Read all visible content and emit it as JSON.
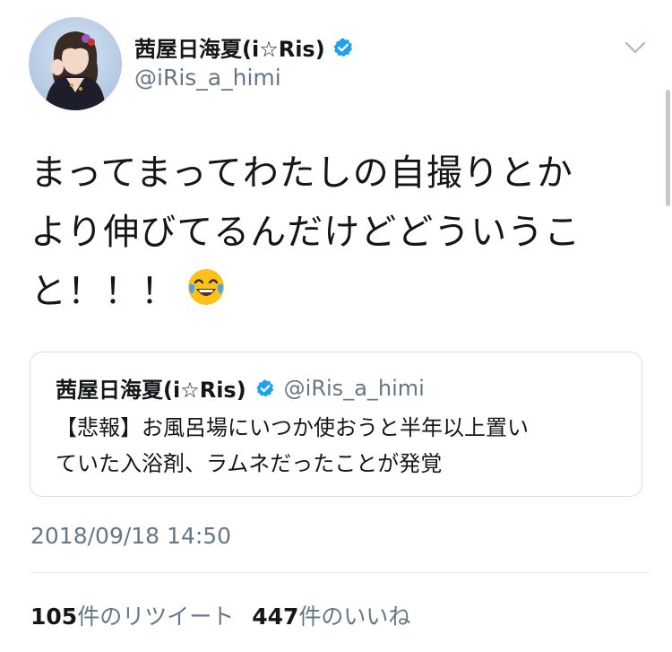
{
  "user": {
    "display_name": "茜屋日海夏(i☆Ris)",
    "handle": "@iRis_a_himi",
    "verified": true
  },
  "tweet": {
    "lines": [
      "まってまってわたしの自撮りとか",
      "より伸びてるんだけどどういうこ",
      "と！！！"
    ],
    "emoji": "face-with-tears-of-joy"
  },
  "quoted_tweet": {
    "display_name": "茜屋日海夏(i☆Ris)",
    "handle": "@iRis_a_himi",
    "lines": [
      "【悲報】お風呂場にいつか使おうと半年以上置い",
      "ていた入浴剤、ラムネだったことが発覚"
    ]
  },
  "timestamp": "2018/09/18 14:50",
  "stats": {
    "retweets_count": "105",
    "retweets_label": "件のリツイート",
    "likes_count": "447",
    "likes_label": "件のいいね"
  },
  "colors": {
    "text": "#14171a",
    "secondary": "#657786",
    "verified_blue": "#1da1f2",
    "border": "#d6dde3"
  },
  "icons": {
    "verified": "verified-badge-icon",
    "caret": "chevron-down-icon"
  }
}
